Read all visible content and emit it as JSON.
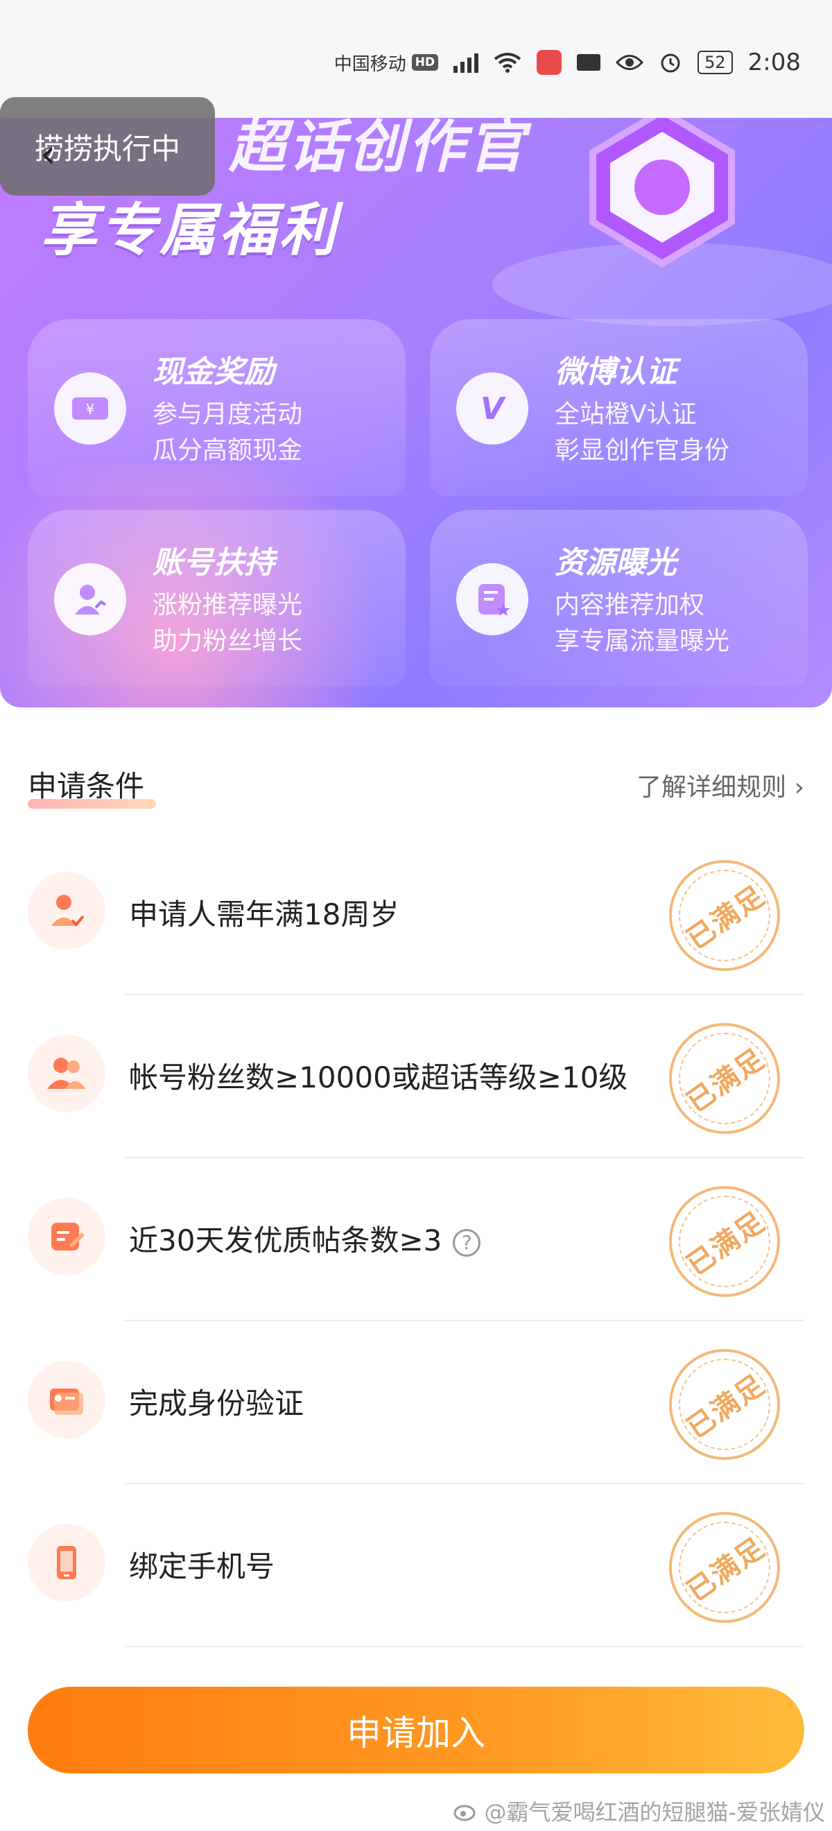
{
  "status_bar": {
    "carrier": "中国移动",
    "hd": "HD",
    "battery": "52",
    "time": "2:08"
  },
  "toast": "捞捞执行中",
  "hero": {
    "title_line1": "超话创作官",
    "title_line2": "享专属福利",
    "benefits": [
      {
        "title": "现金奖励",
        "lines": [
          "参与月度活动",
          "瓜分高额现金"
        ],
        "icon": "ticket-yen-icon"
      },
      {
        "title": "微博认证",
        "lines": [
          "全站橙V认证",
          "彰显创作官身份"
        ],
        "icon": "v-badge-icon"
      },
      {
        "title": "账号扶持",
        "lines": [
          "涨粉推荐曝光",
          "助力粉丝增长"
        ],
        "icon": "user-growth-icon"
      },
      {
        "title": "资源曝光",
        "lines": [
          "内容推荐加权",
          "享专属流量曝光"
        ],
        "icon": "content-star-icon"
      }
    ]
  },
  "conditions": {
    "title": "申请条件",
    "rules_link": "了解详细规则",
    "stamp_text": "已满足",
    "items": [
      {
        "text": "申请人需年满18周岁",
        "icon": "person-check-icon"
      },
      {
        "text": "帐号粉丝数≥10000或超话等级≥10级",
        "icon": "group-icon"
      },
      {
        "text": "近30天发优质帖条数≥3",
        "icon": "edit-note-icon",
        "help": "?"
      },
      {
        "text": "完成身份验证",
        "icon": "id-card-icon"
      },
      {
        "text": "绑定手机号",
        "icon": "phone-icon"
      }
    ]
  },
  "apply_button": "申请加入",
  "watermark": "@霸气爱喝红酒的短腿猫-爱张婧仪",
  "colors": {
    "accent_orange": "#ff8a1a",
    "hero_purple": "#a680ff",
    "stamp": "#f0a960"
  }
}
